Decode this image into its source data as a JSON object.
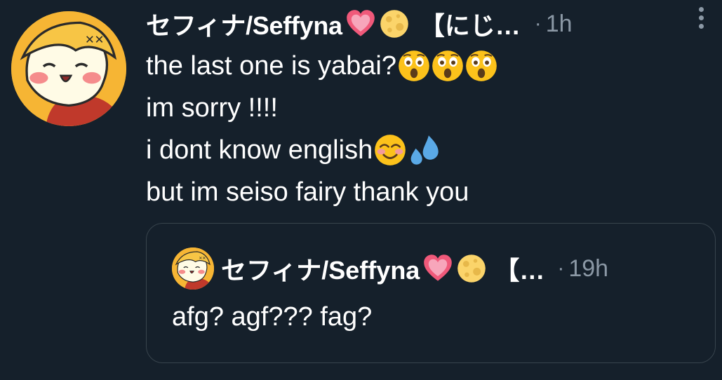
{
  "tweet": {
    "author": {
      "display_name": "セフィナ/Seffyna",
      "name_emojis": [
        "growing-heart-icon",
        "full-moon-icon"
      ],
      "name_suffix": "【にじ…",
      "time": "1h"
    },
    "separator": "·",
    "lines": [
      {
        "text": "the last one is yabai?",
        "emojis": [
          "astonished-face-icon",
          "astonished-face-icon",
          "astonished-face-icon"
        ]
      },
      {
        "text": "im sorry !!!!",
        "emojis": []
      },
      {
        "text": "i dont know english",
        "emojis": [
          "smiling-face-icon",
          "sweat-droplets-icon"
        ]
      },
      {
        "text": "but im seiso fairy thank you",
        "emojis": []
      }
    ],
    "more_icon": "more-options-icon"
  },
  "quote": {
    "author": {
      "display_name": "セフィナ/Seffyna",
      "name_emojis": [
        "growing-heart-icon",
        "full-moon-icon"
      ],
      "name_suffix": "【…",
      "time": "19h"
    },
    "text": "afg? agf??? fag?"
  },
  "colors": {
    "background": "#15202b",
    "text": "#ffffff",
    "secondary_text": "#8b98a5",
    "border": "#38444d"
  }
}
